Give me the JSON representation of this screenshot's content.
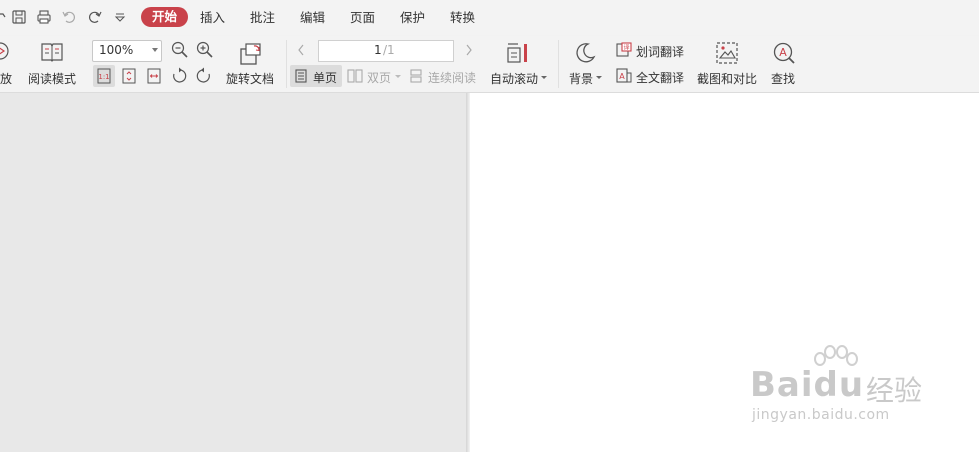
{
  "menu": {
    "tabs": [
      "开始",
      "插入",
      "批注",
      "编辑",
      "页面",
      "保护",
      "转换"
    ],
    "active": "开始"
  },
  "ribbon": {
    "play_label": "放",
    "read_mode_label": "阅读模式",
    "zoom_value": "100%",
    "rotate_label": "旋转文档",
    "page_current": "1",
    "page_total": "/1",
    "single_page_label": "单页",
    "double_page_label": "双页",
    "continuous_label": "连续阅读",
    "auto_scroll_label": "自动滚动",
    "background_label": "背景",
    "word_translate_label": "划词翻译",
    "full_translate_label": "全文翻译",
    "screenshot_compare_label": "截图和对比",
    "find_label": "查找"
  },
  "watermark": {
    "brand": "Baidu",
    "product": "经验",
    "url": "jingyan.baidu.com"
  },
  "colors": {
    "accent": "#c9424a",
    "toolbar_bg": "#f3f3f3",
    "canvas_bg": "#e8e8e8"
  }
}
